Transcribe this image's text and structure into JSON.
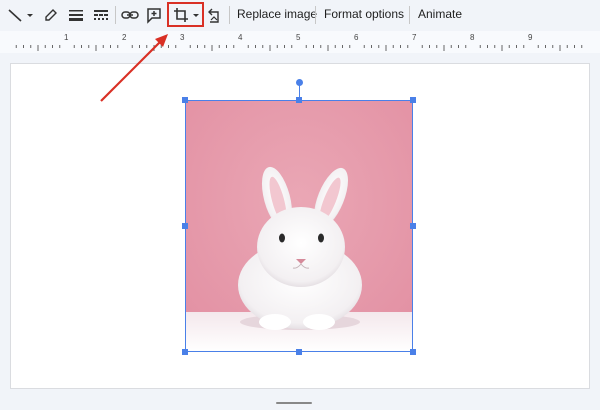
{
  "toolbar": {
    "icons": [
      "line-icon",
      "pen-icon",
      "line-weight-icon",
      "line-dash-icon",
      "link-icon",
      "comment-icon",
      "crop-icon",
      "reset-image-icon"
    ],
    "replace_image": "Replace image",
    "format_options": "Format options",
    "animate": "Animate"
  },
  "ruler": {
    "labels": [
      "1",
      "2",
      "3",
      "4",
      "5",
      "6",
      "7",
      "8",
      "9"
    ]
  },
  "colors": {
    "selection": "#4a80e8",
    "highlight": "#d93025",
    "image_background": "#e8a0ae"
  },
  "image": {
    "subject": "white rabbit on pink background"
  }
}
